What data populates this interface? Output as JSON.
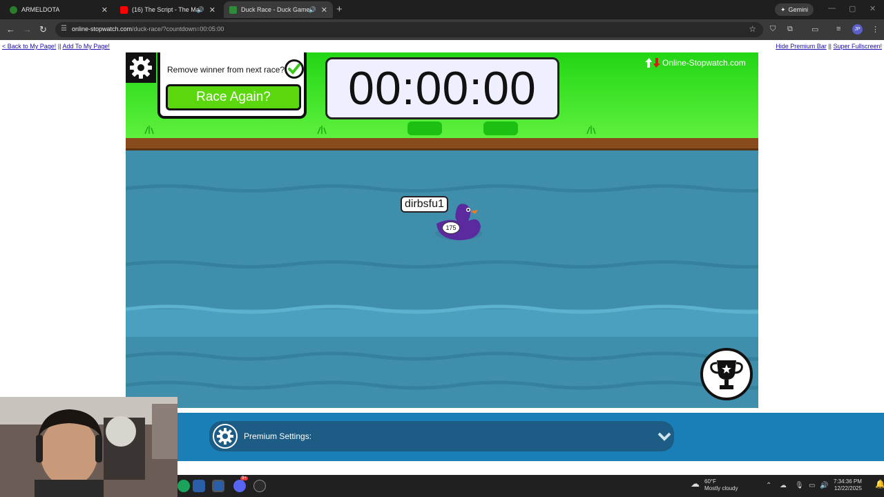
{
  "browser": {
    "tabs": [
      {
        "title": "ARMELDOTA",
        "favicon_color": "#2a7d2a"
      },
      {
        "title": "(16) The Script - The Man W",
        "favicon_color": "#ff0000"
      },
      {
        "title": "Duck Race - Duck Games",
        "favicon_color": "#2e8b3a"
      }
    ],
    "gemini_label": "Gemini",
    "url_host": "online-stopwatch.com",
    "url_path": "/duck-race/?countdown=00:05:00",
    "profile_initials": "JP"
  },
  "page": {
    "links_left": {
      "back": "< Back to My Page!",
      "sep": "||",
      "add": "Add To My Page!"
    },
    "links_right": {
      "hide": "Hide Premium Bar",
      "sep": "||",
      "fullscreen": "Super Fullscreen!"
    }
  },
  "game": {
    "remove_winner_label": "Remove winner from next race?",
    "remove_winner_checked": true,
    "race_again_label": "Race Again?",
    "timer": "00:00:00",
    "brand": "Online-Stopwatch.com",
    "duck": {
      "name": "dirbsfu1",
      "number": "175",
      "color": "#5b2a9e"
    }
  },
  "premium": {
    "label": "Premium Settings:"
  },
  "taskbar": {
    "weather_temp": "60°F",
    "weather_desc": "Mostly cloudy",
    "time": "7:34:36 PM",
    "date": "12/22/2025",
    "discord_badge": "9+"
  },
  "colors": {
    "grass": "#22d614",
    "water": "#3f8eab",
    "race_button": "#5bd80d",
    "premium_bar": "#1a7fb6"
  }
}
